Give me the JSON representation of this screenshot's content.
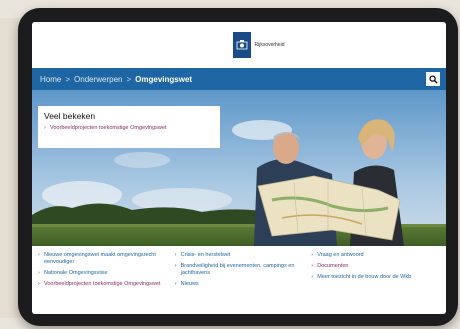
{
  "header": {
    "logo_text": "Rijksoverheid"
  },
  "nav": {
    "crumbs": [
      "Home",
      "Onderwerpen"
    ],
    "current": "Omgevingswet",
    "separator": ">"
  },
  "popular": {
    "title": "Veel bekeken",
    "link": "Voorbeeldprojecten toekomstige Omgevingswet"
  },
  "links": {
    "col1": [
      "Nieuwe omgevingswet maakt omgevingsrecht eenvoudiger",
      "Nationale Omgevingsvisie",
      "Voorbeeldprojecten toekomstige Omgevingswet"
    ],
    "col2": [
      "Crisis- en herstelwet",
      "Brandveiligheid bij evenementen, campings en jachthavens",
      "Nieuws"
    ],
    "col3": [
      "Vraag en antwoord",
      "Documenten",
      "Meer toezicht in de bouw door de Wkb"
    ]
  },
  "colors": {
    "nav_blue": "#1e66a3",
    "link_blue": "#1e66a3",
    "visited_purple": "#8a2b67",
    "bezel": "#1c1c1e"
  }
}
